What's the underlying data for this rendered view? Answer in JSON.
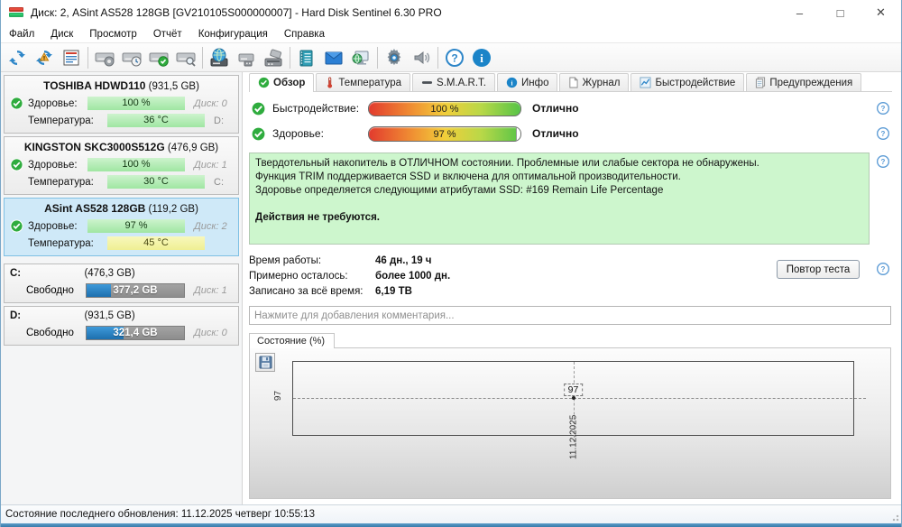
{
  "window": {
    "title": "Диск: 2, ASint AS528 128GB [GV210105S000000007]  -  Hard Disk Sentinel 6.30 PRO",
    "minimize": "–",
    "maximize": "□",
    "close": "✕"
  },
  "menu": {
    "items": [
      "Файл",
      "Диск",
      "Просмотр",
      "Отчёт",
      "Конфигурация",
      "Справка"
    ]
  },
  "toolbar": {
    "icons": [
      "refresh-icon",
      "refresh-warning-icon",
      "report-icon",
      "disk-detect-icon",
      "disk-clock-icon",
      "disk-ok-icon",
      "disk-search-icon",
      "disk-network-icon",
      "disk-usb-icon",
      "disk-dock-icon",
      "notes-icon",
      "email-icon",
      "network-status-icon",
      "settings-gear-icon",
      "sounds-icon",
      "help-icon",
      "info-icon"
    ]
  },
  "sidebar": {
    "disks": [
      {
        "name": "TOSHIBA HDWD110",
        "size": "(931,5 GB)",
        "health_label": "Здоровье:",
        "health": "100 %",
        "disk_no": "Диск: 0",
        "temp_label": "Температура:",
        "temp": "36 °C",
        "drive": "D:"
      },
      {
        "name": "KINGSTON SKC3000S512G",
        "size": "(476,9 GB)",
        "health_label": "Здоровье:",
        "health": "100 %",
        "disk_no": "Диск: 1",
        "temp_label": "Температура:",
        "temp": "30 °C",
        "drive": "C:"
      },
      {
        "name": "ASint AS528 128GB",
        "size": "(119,2 GB)",
        "health_label": "Здоровье:",
        "health": "97 %",
        "disk_no": "Диск: 2",
        "temp_label": "Температура:",
        "temp": "45 °C",
        "drive": ""
      }
    ],
    "partitions": [
      {
        "letter": "C:",
        "size": "(476,3 GB)",
        "free_label": "Свободно",
        "free": "377,2 GB",
        "disk_no": "Диск: 1",
        "blue_pct": 25
      },
      {
        "letter": "D:",
        "size": "(931,5 GB)",
        "free_label": "Свободно",
        "free": "321,4 GB",
        "disk_no": "Диск: 0",
        "blue_pct": 38
      }
    ]
  },
  "main": {
    "tabs": [
      {
        "label": "Обзор"
      },
      {
        "label": "Температура"
      },
      {
        "label": "S.M.A.R.T."
      },
      {
        "label": "Инфо"
      },
      {
        "label": "Журнал"
      },
      {
        "label": "Быстродействие"
      },
      {
        "label": "Предупреждения"
      }
    ],
    "overview": {
      "performance_label": "Быстродействие:",
      "performance_value": "100 %",
      "performance_pct": 100,
      "performance_rating": "Отлично",
      "health_label": "Здоровье:",
      "health_value": "97 %",
      "health_pct": 97,
      "health_rating": "Отлично",
      "advice_line1": "Твердотельный накопитель в ОТЛИЧНОМ состоянии. Проблемные или слабые сектора не обнаружены.",
      "advice_line2": "Функция TRIM поддерживается SSD и включена для оптимальной производительности.",
      "advice_line3": "Здоровье определяется следующими атрибутами SSD: #169 Remain Life Percentage",
      "advice_action": "Действия не требуются.",
      "poweron_label": "Время работы:",
      "poweron_value": "46 дн., 19 ч",
      "remaining_label": "Примерно осталось:",
      "remaining_value": "более 1000 дн.",
      "written_label": "Записано за всё время:",
      "written_value": "6,19 TB",
      "retest_button": "Повтор теста",
      "comment_placeholder": "Нажмите для добавления комментария..."
    }
  },
  "chart_data": {
    "type": "line",
    "title": "Состояние (%)",
    "x": [
      "11.12.2025"
    ],
    "values": [
      97
    ],
    "series": [
      {
        "name": "Состояние (%)",
        "values": [
          97
        ]
      }
    ],
    "point_label": "97",
    "y_axis_tick": "97",
    "x_axis_tick": "11.12.2025",
    "grid": "dashed-crosshair",
    "legend_position": "none"
  },
  "statusbar": {
    "text": "Состояние последнего обновления: 11.12.2025 четверг 10:55:13"
  }
}
